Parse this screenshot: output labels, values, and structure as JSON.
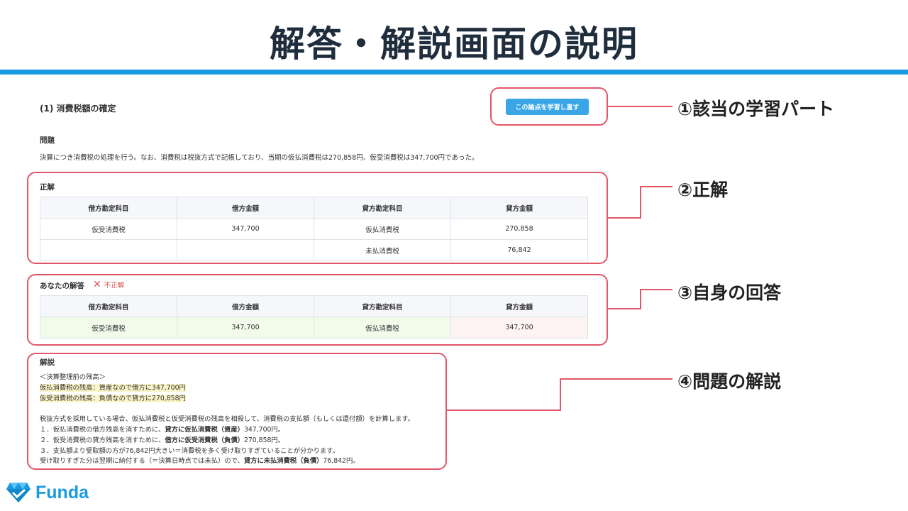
{
  "slide": {
    "title": "解答・解説画面の説明"
  },
  "question": {
    "section_title": "(1) 消費税額の確定",
    "relearn_button": "この論点を学習し直す",
    "label": "問題",
    "text": "決算につき消費税の処理を行う。なお、消費税は税抜方式で記帳しており、当期の仮払消費税は270,858円、仮受消費税は347,700円であった。"
  },
  "correct": {
    "label": "正解",
    "headers": [
      "借方勘定科目",
      "借方金額",
      "貸方勘定科目",
      "貸方金額"
    ],
    "rows": [
      [
        "仮受消費税",
        "347,700",
        "仮払消費税",
        "270,858"
      ],
      [
        "",
        "",
        "未払消費税",
        "76,842"
      ]
    ]
  },
  "yours": {
    "label": "あなたの解答",
    "status": "不正解",
    "headers": [
      "借方勘定科目",
      "借方金額",
      "貸方勘定科目",
      "貸方金額"
    ],
    "rows": [
      [
        "仮受消費税",
        "347,700",
        "仮払消費税",
        "347,700"
      ]
    ]
  },
  "explanation": {
    "label": "解説",
    "line1": "＜決算整理前の残高＞",
    "line2": "仮払消費税の残高：資産なので借方に347,700円",
    "line3": "仮受消費税の残高：負債なので貸方に270,858円",
    "line4": "税抜方式を採用している場合、仮払消費税と仮受消費税の残高を相殺して、消費税の支払額（もしくは還付額）を計算します。",
    "line5_a": "１．仮払消費税の借方残高を消すために、",
    "line5_b": "貸方に仮払消費税（資産）",
    "line5_c": "347,700円。",
    "line6_a": "２．仮受消費税の貸方残高を消すために、",
    "line6_b": "借方に仮受消費税（負債）",
    "line6_c": "270,858円。",
    "line7": "３．支払額より受取額の方が76,842円大きい＝消費税を多く受け取りすぎていることが分かります。",
    "line8_a": "受け取りすぎた分は翌期に納付する（＝決算日時点では未払）ので、",
    "line8_b": "貸方に未払消費税（負債）",
    "line8_c": "76,842円。"
  },
  "callouts": {
    "c1": "①該当の学習パート",
    "c2": "②正解",
    "c3": "③自身の回答",
    "c4": "④問題の解説"
  },
  "brand": {
    "name": "Funda",
    "icon": "diamond-icon"
  },
  "colors": {
    "accent": "#1a9ae0",
    "frame": "#e0566a",
    "button": "#3aa6e6",
    "error": "#d9534f"
  }
}
